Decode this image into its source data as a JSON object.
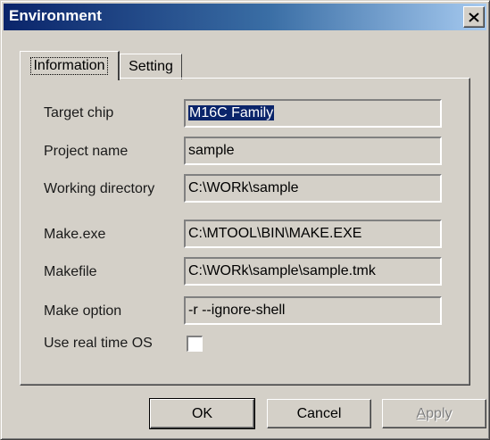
{
  "window": {
    "title": "Environment",
    "close_glyph": "✕"
  },
  "tabs": [
    {
      "label": "Information",
      "active": true
    },
    {
      "label": "Setting",
      "active": false
    }
  ],
  "fields": {
    "target_chip": {
      "label": "Target chip",
      "value": "M16C Family"
    },
    "project_name": {
      "label": "Project name",
      "value": "sample"
    },
    "working_directory": {
      "label": "Working directory",
      "value": "C:\\WORk\\sample"
    },
    "make_exe": {
      "label": "Make.exe",
      "value": "C:\\MTOOL\\BIN\\MAKE.EXE"
    },
    "makefile": {
      "label": "Makefile",
      "value": "C:\\WORk\\sample\\sample.tmk"
    },
    "make_option": {
      "label": "Make option",
      "value": "-r --ignore-shell"
    },
    "use_rtos": {
      "label": "Use real time OS",
      "checked": false
    }
  },
  "buttons": {
    "ok": "OK",
    "cancel": "Cancel",
    "apply_first": "A",
    "apply_rest": "pply"
  },
  "colors": {
    "dialog_face": "#d4d0c8",
    "title_active": "#0a246a",
    "selection": "#0a246a",
    "disabled_text": "#808080"
  }
}
